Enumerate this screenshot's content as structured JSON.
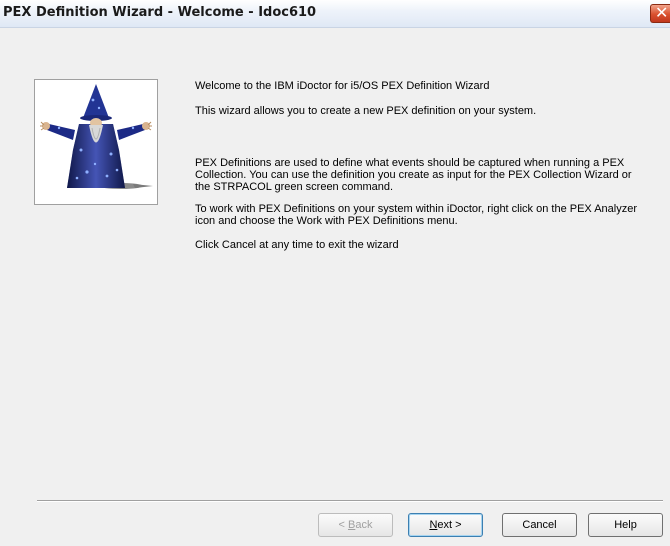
{
  "window": {
    "title": "PEX Definition Wizard - Welcome - Idoc610",
    "close_glyph": "✕"
  },
  "content": {
    "line1": "Welcome to the IBM iDoctor for i5/OS PEX Definition Wizard",
    "line2": "This wizard allows you to create a new PEX definition on your system.",
    "para3": "PEX Definitions are used to define what events should be captured when running a PEX Collection.  You can use the definition you create as input for the PEX Collection Wizard or the STRPACOL green screen command.",
    "para4": "To work with PEX Definitions on your system within iDoctor, right click on the PEX Analyzer icon and choose the Work with PEX Definitions menu.",
    "para5": "Click Cancel at any time to exit the wizard"
  },
  "buttons": {
    "back": {
      "mnemonic": "B",
      "rest": "ack",
      "prefix": "< ",
      "enabled": false
    },
    "next": {
      "mnemonic": "N",
      "rest": "ext >"
    },
    "cancel": "Cancel",
    "help": "Help"
  },
  "icons": {
    "wizard_image": "wizard-illustration",
    "close": "close-icon"
  }
}
